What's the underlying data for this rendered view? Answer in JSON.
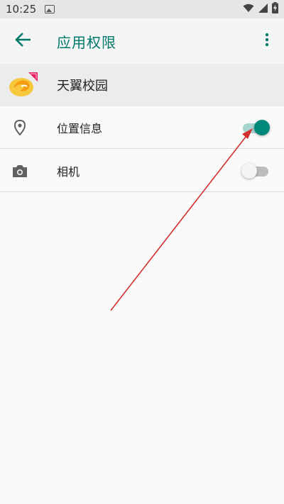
{
  "status_bar": {
    "time": "10:25",
    "icons": [
      "image-icon",
      "wifi-icon",
      "signal-icon",
      "battery-charging-icon"
    ]
  },
  "app_bar": {
    "title": "应用权限",
    "back_icon": "arrow-back-icon",
    "more_icon": "more-vert-icon"
  },
  "app_header": {
    "name": "天翼校园",
    "icon": "app-logo-icon"
  },
  "permissions": [
    {
      "label": "位置信息",
      "icon": "location-pin-icon",
      "enabled": true
    },
    {
      "label": "相机",
      "icon": "camera-icon",
      "enabled": false
    }
  ],
  "colors": {
    "accent": "#00796b",
    "toggle_on_thumb": "#00897b",
    "toggle_on_track": "#a6d4cf",
    "annotation_arrow": "#d32f2f"
  }
}
